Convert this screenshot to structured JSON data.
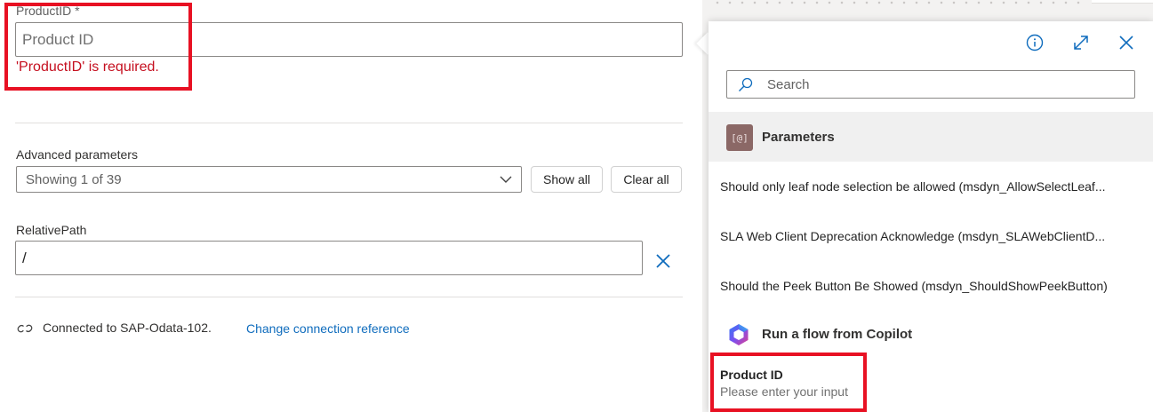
{
  "form": {
    "product_id": {
      "label": "ProductID *",
      "placeholder": "Product ID",
      "error": "'ProductID' is required."
    },
    "advanced": {
      "label": "Advanced parameters",
      "selected": "Showing 1 of 39",
      "show_all": "Show all",
      "clear_all": "Clear all"
    },
    "relative_path": {
      "label": "RelativePath",
      "value": "/"
    },
    "connection": {
      "text": "Connected to SAP-Odata-102.",
      "change_link": "Change connection reference"
    }
  },
  "popup": {
    "search_placeholder": "Search",
    "parameters_badge": "[@]",
    "parameters_title": "Parameters",
    "parameter_items": [
      "Should only leaf node selection be allowed (msdyn_AllowSelectLeaf...",
      "SLA Web Client Deprecation Acknowledge (msdyn_SLAWebClientD...",
      "Should the Peek Button Be Showed (msdyn_ShouldShowPeekButton)"
    ],
    "flow_title": "Run a flow from Copilot",
    "flow_item": {
      "title": "Product ID",
      "description": "Please enter your input"
    }
  },
  "colors": {
    "error_red": "#c50f1f",
    "highlight_red": "#e81123",
    "link_blue": "#0f6cbd",
    "icon_blue": "#0f6cbd",
    "param_badge": "#8b6866"
  }
}
